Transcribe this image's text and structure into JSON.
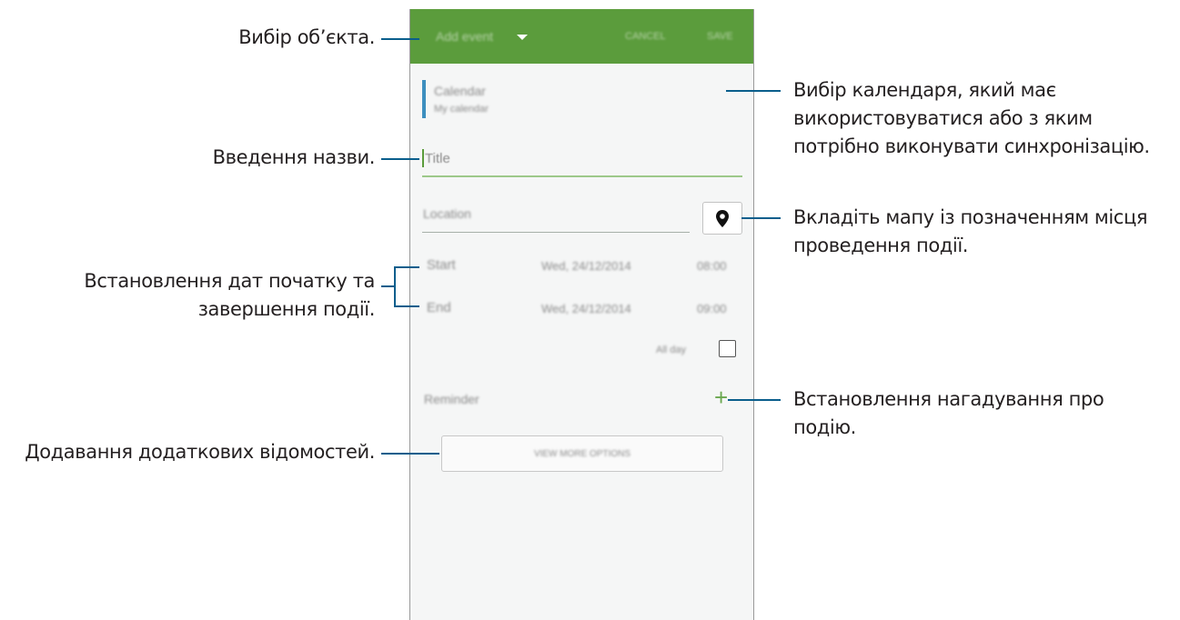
{
  "callouts": {
    "object_select": "Вибір об’єкта.",
    "calendar_select": [
      "Вибір календаря, який має",
      "використовуватися або з яким",
      "потрібно виконувати синхронізацію."
    ],
    "title_input": "Введення назви.",
    "map_attach": [
      "Вкладіть мапу із позначенням місця",
      "проведення події."
    ],
    "dates": [
      "Встановлення дат початку та",
      "завершення події."
    ],
    "reminder": [
      "Встановлення нагадування про",
      "подію."
    ],
    "more_details": "Додавання додаткових відомостей."
  },
  "phone": {
    "topbar": {
      "object": "Add event",
      "cancel": "CANCEL",
      "save": "SAVE"
    },
    "calendar": {
      "label": "Calendar",
      "account": "My calendar"
    },
    "title_placeholder": "Title",
    "location_placeholder": "Location",
    "start": {
      "label": "Start",
      "date": "Wed, 24/12/2014",
      "time": "08:00"
    },
    "end": {
      "label": "End",
      "date": "Wed, 24/12/2014",
      "time": "09:00"
    },
    "all_day": "All day",
    "reminder": "Reminder",
    "more_options": "VIEW MORE OPTIONS"
  },
  "colors": {
    "topbar": "#5b9c3c",
    "callout_line": "#0a5e8c",
    "accent_plus": "#6aa84f"
  },
  "icons": [
    "dropdown-arrow-icon",
    "map-pin-icon",
    "plus-icon",
    "checkbox-icon"
  ]
}
